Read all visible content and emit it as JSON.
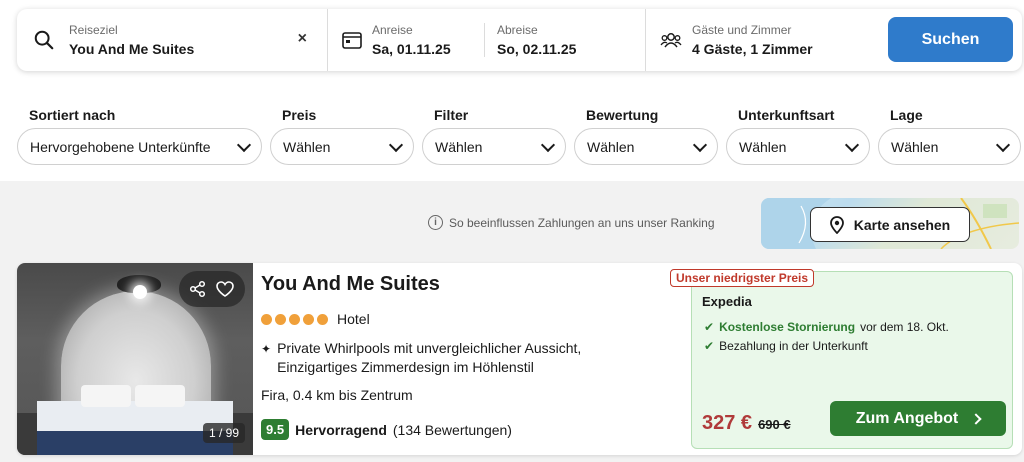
{
  "search": {
    "destination_label": "Reiseziel",
    "destination_value": "You And Me Suites",
    "clear_glyph": "×",
    "checkin_label": "Anreise",
    "checkin_value": "Sa, 01.11.25",
    "checkout_label": "Abreise",
    "checkout_value": "So, 02.11.25",
    "guests_label": "Gäste und Zimmer",
    "guests_value": "4 Gäste, 1 Zimmer",
    "search_button": "Suchen"
  },
  "filters": [
    {
      "title": "Sortiert nach",
      "value": "Hervorgehobene Unterkünfte"
    },
    {
      "title": "Preis",
      "value": "Wählen"
    },
    {
      "title": "Filter",
      "value": "Wählen"
    },
    {
      "title": "Bewertung",
      "value": "Wählen"
    },
    {
      "title": "Unterkunftsart",
      "value": "Wählen"
    },
    {
      "title": "Lage",
      "value": "Wählen"
    }
  ],
  "ranking_note": "So beeinflussen Zahlungen an uns unser Ranking",
  "map_button": "Karte ansehen",
  "listing": {
    "name": "You And Me Suites",
    "stars": 5,
    "type": "Hotel",
    "feature": "Private Whirlpools mit unvergleichlicher Aussicht, Einzigartiges Zimmerdesign im Höhlenstil",
    "location": "Fira, 0.4 km bis Zentrum",
    "score": "9.5",
    "rating_word": "Hervorragend",
    "reviews": "(134 Bewertungen)",
    "photo_counter": "1 / 99",
    "offer": {
      "badge": "Unser niedrigster Preis",
      "provider": "Expedia",
      "bullet1_strong": "Kostenlose Stornierung",
      "bullet1_rest": "vor dem 18. Okt.",
      "bullet2": "Bezahlung in der Unterkunft",
      "price_now": "327 €",
      "price_old": "690 €",
      "cta": "Zum Angebot"
    }
  },
  "colors": {
    "primary_blue": "#2f7bcb",
    "deal_green": "#2e7d32",
    "price_red": "#b03a3a",
    "offer_bg": "#eaf8ea"
  }
}
